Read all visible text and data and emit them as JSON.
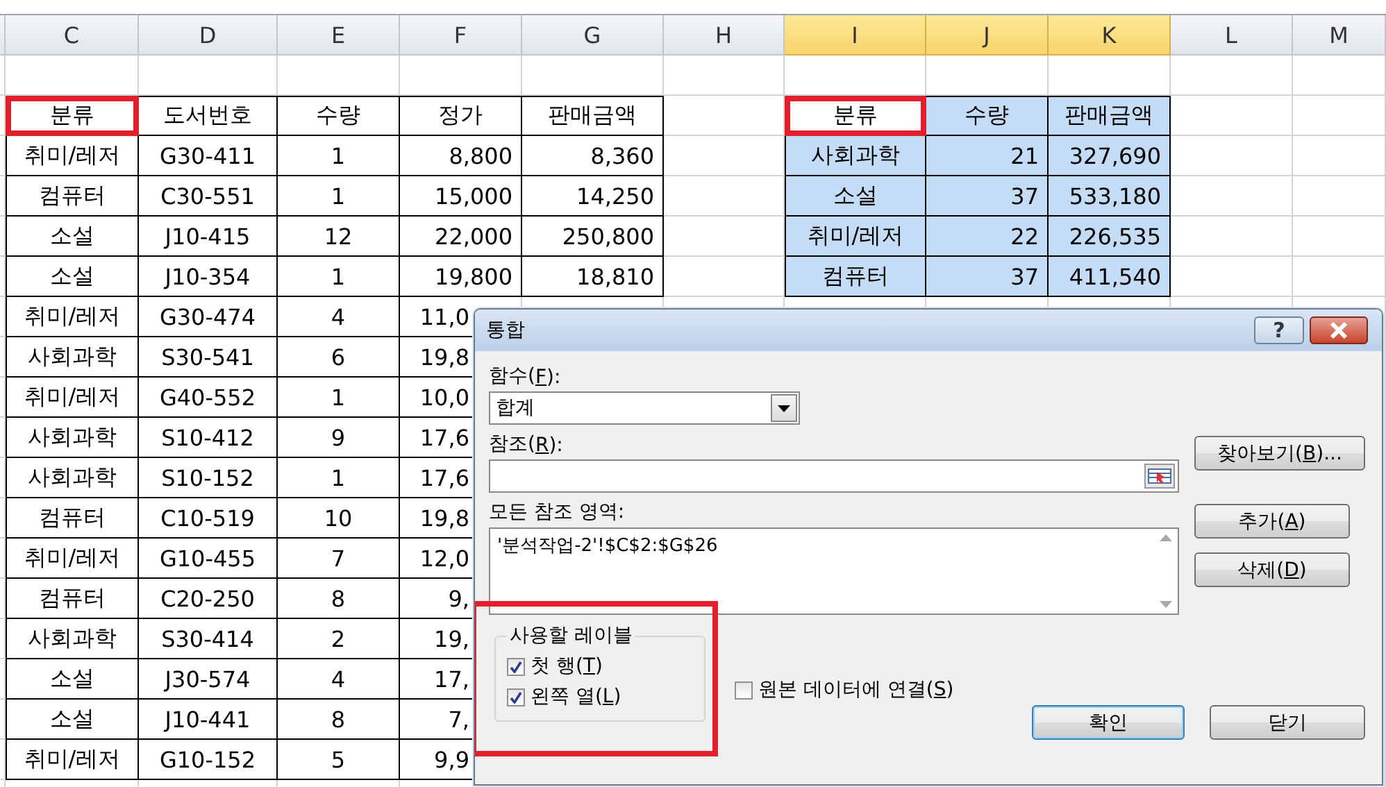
{
  "columns": [
    {
      "label": "C",
      "selected": false
    },
    {
      "label": "D",
      "selected": false
    },
    {
      "label": "E",
      "selected": false
    },
    {
      "label": "F",
      "selected": false
    },
    {
      "label": "G",
      "selected": false
    },
    {
      "label": "H",
      "selected": false
    },
    {
      "label": "I",
      "selected": true
    },
    {
      "label": "J",
      "selected": true
    },
    {
      "label": "K",
      "selected": true
    },
    {
      "label": "L",
      "selected": false
    },
    {
      "label": "M",
      "selected": false
    }
  ],
  "left_table": {
    "header": [
      {
        "text": "분류",
        "highlighted": true
      },
      {
        "text": "도서번호",
        "highlighted": false
      },
      {
        "text": "수량",
        "highlighted": false
      },
      {
        "text": "정가",
        "highlighted": false
      },
      {
        "text": "판매금액",
        "highlighted": false
      }
    ],
    "rows": [
      {
        "category": "취미/레저",
        "book_no": "G30-411",
        "quantity": "1",
        "price": "8,800",
        "sales": "8,360"
      },
      {
        "category": "컴퓨터",
        "book_no": "C30-551",
        "quantity": "1",
        "price": "15,000",
        "sales": "14,250"
      },
      {
        "category": "소설",
        "book_no": "J10-415",
        "quantity": "12",
        "price": "22,000",
        "sales": "250,800"
      },
      {
        "category": "소설",
        "book_no": "J10-354",
        "quantity": "1",
        "price": "19,800",
        "sales": "18,810"
      },
      {
        "category": "취미/레저",
        "book_no": "G30-474",
        "quantity": "4",
        "price": "11,0"
      },
      {
        "category": "사회과학",
        "book_no": "S30-541",
        "quantity": "6",
        "price": "19,8"
      },
      {
        "category": "취미/레저",
        "book_no": "G40-552",
        "quantity": "1",
        "price": "10,0"
      },
      {
        "category": "사회과학",
        "book_no": "S10-412",
        "quantity": "9",
        "price": "17,6"
      },
      {
        "category": "사회과학",
        "book_no": "S10-152",
        "quantity": "1",
        "price": "17,6"
      },
      {
        "category": "컴퓨터",
        "book_no": "C10-519",
        "quantity": "10",
        "price": "19,8"
      },
      {
        "category": "취미/레저",
        "book_no": "G10-455",
        "quantity": "7",
        "price": "12,0"
      },
      {
        "category": "컴퓨터",
        "book_no": "C20-250",
        "quantity": "8",
        "price": "9,"
      },
      {
        "category": "사회과학",
        "book_no": "S30-414",
        "quantity": "2",
        "price": "19,"
      },
      {
        "category": "소설",
        "book_no": "J30-574",
        "quantity": "4",
        "price": "17,"
      },
      {
        "category": "소설",
        "book_no": "J10-441",
        "quantity": "8",
        "price": "7,"
      },
      {
        "category": "취미/레저",
        "book_no": "G10-152",
        "quantity": "5",
        "price": "9,9"
      }
    ]
  },
  "right_table": {
    "header": [
      {
        "text": "분류",
        "active": true,
        "highlighted": true
      },
      {
        "text": "수량",
        "active": false,
        "highlighted": false
      },
      {
        "text": "판매금액",
        "active": false,
        "highlighted": false
      }
    ],
    "rows": [
      {
        "category": "사회과학",
        "quantity": "21",
        "sales": "327,690"
      },
      {
        "category": "소설",
        "quantity": "37",
        "sales": "533,180"
      },
      {
        "category": "취미/레저",
        "quantity": "22",
        "sales": "226,535"
      },
      {
        "category": "컴퓨터",
        "quantity": "37",
        "sales": "411,540"
      }
    ]
  },
  "dialog": {
    "title": "통합",
    "help": "?",
    "function_label": [
      "함수(",
      "F",
      "):"
    ],
    "function_value": "합계",
    "reference_label": [
      "참조(",
      "R",
      "):"
    ],
    "browse_button": [
      "찾아보기(",
      "B",
      ")..."
    ],
    "all_references_label": [
      "모든 참조 영역:"
    ],
    "all_references": [
      "'분석작업-2'!$C$2:$G$26"
    ],
    "add_button": [
      "추가(",
      "A",
      ")"
    ],
    "delete_button": [
      "삭제(",
      "D",
      ")"
    ],
    "labels_group": {
      "title": "사용할 레이블",
      "highlighted": true,
      "options": [
        {
          "label": [
            "첫 행(",
            "T",
            ")"
          ],
          "checked": true
        },
        {
          "label": [
            "왼쪽 열(",
            "L",
            ")"
          ],
          "checked": true
        }
      ]
    },
    "link_option": {
      "label": [
        "원본 데이터에 연결(",
        "S",
        ")"
      ],
      "checked": false
    },
    "ok_button": {
      "label": "확인",
      "default": true
    },
    "close_button": {
      "label": "닫기",
      "default": false
    }
  }
}
